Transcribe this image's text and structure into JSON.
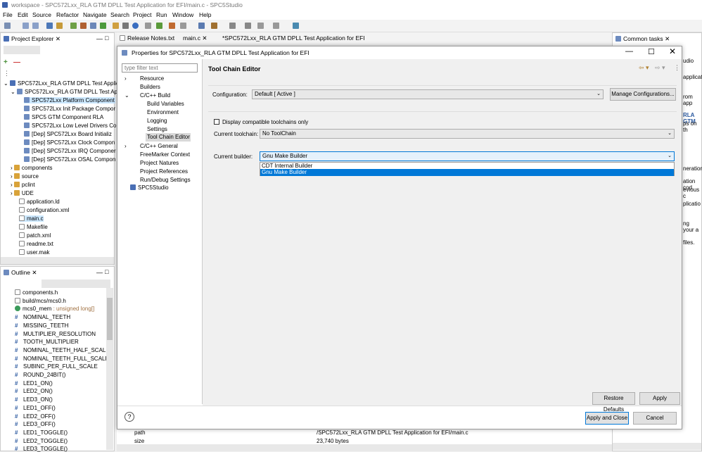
{
  "window": {
    "title": "workspace - SPC572Lxx_RLA GTM DPLL Test Application for EFI/main.c - SPC5Studio"
  },
  "menu": [
    "File",
    "Edit",
    "Source",
    "Refactor",
    "Navigate",
    "Search",
    "Project",
    "Run",
    "Window",
    "Help"
  ],
  "editor_tabs": [
    "Release Notes.txt",
    "main.c",
    "*SPC572Lxx_RLA GTM DPLL Test Application for EFI"
  ],
  "project_explorer": {
    "title": "Project Explorer",
    "items": [
      "SPC572Lxx_RLA GTM DPLL Test Applic",
      "SPC572Lxx_RLA GTM DPLL Test App",
      "SPC572Lxx Platform Component",
      "SPC572Lxx Init Package Compor",
      "SPC5 GTM Component RLA",
      "SPC572Lxx Low Level Drivers Co",
      "[Dep] SPC572Lxx Board Initializ",
      "[Dep] SPC572Lxx Clock Compon",
      "[Dep] SPC572Lxx IRQ Componer",
      "[Dep] SPC572Lxx OSAL Compon",
      "components",
      "source",
      "pclint",
      "UDE",
      "application.ld",
      "configuration.xml",
      "main.c",
      "Makefile",
      "patch.xml",
      "readme.txt",
      "user.mak"
    ]
  },
  "outline": {
    "title": "Outline",
    "items": [
      {
        "t": "components.h",
        "k": "file"
      },
      {
        "t": "build/mcs/mcs0.h",
        "k": "file"
      },
      {
        "t": "mcs0_mem",
        "k": "var",
        "type": " : unsigned long[]"
      },
      {
        "t": "NOMINAL_TEETH",
        "k": "hash"
      },
      {
        "t": "MISSING_TEETH",
        "k": "hash"
      },
      {
        "t": "MULTIPLIER_RESOLUTION",
        "k": "hash"
      },
      {
        "t": "TOOTH_MULTIPLIER",
        "k": "hash"
      },
      {
        "t": "NOMINAL_TEETH_HALF_SCALE",
        "k": "hash"
      },
      {
        "t": "NOMINAL_TEETH_FULL_SCALE",
        "k": "hash"
      },
      {
        "t": "SUBINC_PER_FULL_SCALE",
        "k": "hash"
      },
      {
        "t": "ROUND_24BIT()",
        "k": "hash"
      },
      {
        "t": "LED1_ON()",
        "k": "hash"
      },
      {
        "t": "LED2_ON()",
        "k": "hash"
      },
      {
        "t": "LED3_ON()",
        "k": "hash"
      },
      {
        "t": "LED1_OFF()",
        "k": "hash"
      },
      {
        "t": "LED2_OFF()",
        "k": "hash"
      },
      {
        "t": "LED3_OFF()",
        "k": "hash"
      },
      {
        "t": "LED1_TOGGLE()",
        "k": "hash"
      },
      {
        "t": "LED2_TOGGLE()",
        "k": "hash"
      },
      {
        "t": "LED3_TOGGLE()",
        "k": "hash"
      }
    ]
  },
  "common_tasks": {
    "title": "Common tasks",
    "fragments": [
      "udio",
      "applicat",
      "rom app",
      "RLA GTM",
      "ps on th",
      "neration",
      "ation cod",
      "evious c",
      "plicatio",
      "ng your a",
      "files."
    ]
  },
  "dialog": {
    "title": "Properties for SPC572Lxx_RLA GTM DPLL Test Application for EFI",
    "filter_placeholder": "type filter text",
    "nav": [
      "Resource",
      "Builders",
      "C/C++ Build",
      "Build Variables",
      "Environment",
      "Logging",
      "Settings",
      "Tool Chain Editor",
      "C/C++ General",
      "FreeMarker Context",
      "Project Natures",
      "Project References",
      "Run/Debug Settings",
      "SPC5Studio"
    ],
    "page_title": "Tool Chain Editor",
    "configuration_label": "Configuration:",
    "configuration_value": "Default  [ Active ]",
    "manage_button": "Manage Configurations...",
    "display_compatible": "Display compatible toolchains only",
    "toolchain_label": "Current toolchain:",
    "toolchain_value": "No ToolChain",
    "builder_label": "Current builder:",
    "builder_value": "Gnu Make Builder",
    "builder_options": [
      "CDT Internal Builder",
      "Gnu Make Builder"
    ],
    "restore_defaults": "Restore Defaults",
    "apply": "Apply",
    "apply_and_close": "Apply and Close",
    "cancel": "Cancel",
    "help": "?"
  },
  "properties_view": {
    "rows": [
      {
        "k": "path",
        "v": "/SPC572Lxx_RLA GTM DPLL Test Application for EFI/main.c"
      },
      {
        "k": "size",
        "v": "23,740  bytes"
      }
    ]
  },
  "colors": {
    "selection": "#cce8ff",
    "dropdown_highlight": "#0078d7",
    "accent": "#0078d7"
  }
}
